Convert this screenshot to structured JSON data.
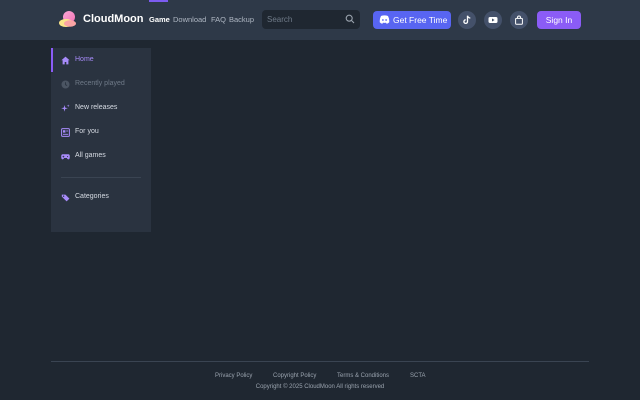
{
  "header": {
    "brand": "CloudMoon",
    "nav": [
      "Game",
      "Download",
      "FAQ",
      "Backup"
    ],
    "active_nav": "Game",
    "search_placeholder": "Search",
    "discord_label": "Get Free Time",
    "signin_label": "Sign In",
    "icons": [
      "tiktok-icon",
      "youtube-icon",
      "shopping-bag-icon"
    ],
    "colors": {
      "accent": "#8b5cf6",
      "discord": "#5865f2",
      "header_bg": "#2e3948",
      "page_bg": "#1f2731"
    }
  },
  "sidebar": {
    "items": [
      {
        "label": "Home",
        "icon": "home-icon",
        "active": true
      },
      {
        "label": "Recently played",
        "icon": "clock-icon",
        "disabled": true
      },
      {
        "label": "New releases",
        "icon": "sparkle-icon"
      },
      {
        "label": "For you",
        "icon": "for-you-icon"
      },
      {
        "label": "All games",
        "icon": "gamepad-icon"
      },
      {
        "label": "Categories",
        "icon": "tag-icon"
      }
    ]
  },
  "footer": {
    "links": [
      "Privacy Policy",
      "Copyright Policy",
      "Terms & Conditions",
      "SCTA"
    ],
    "copyright": "Copyright © 2025 CloudMoon All rights reserved"
  }
}
